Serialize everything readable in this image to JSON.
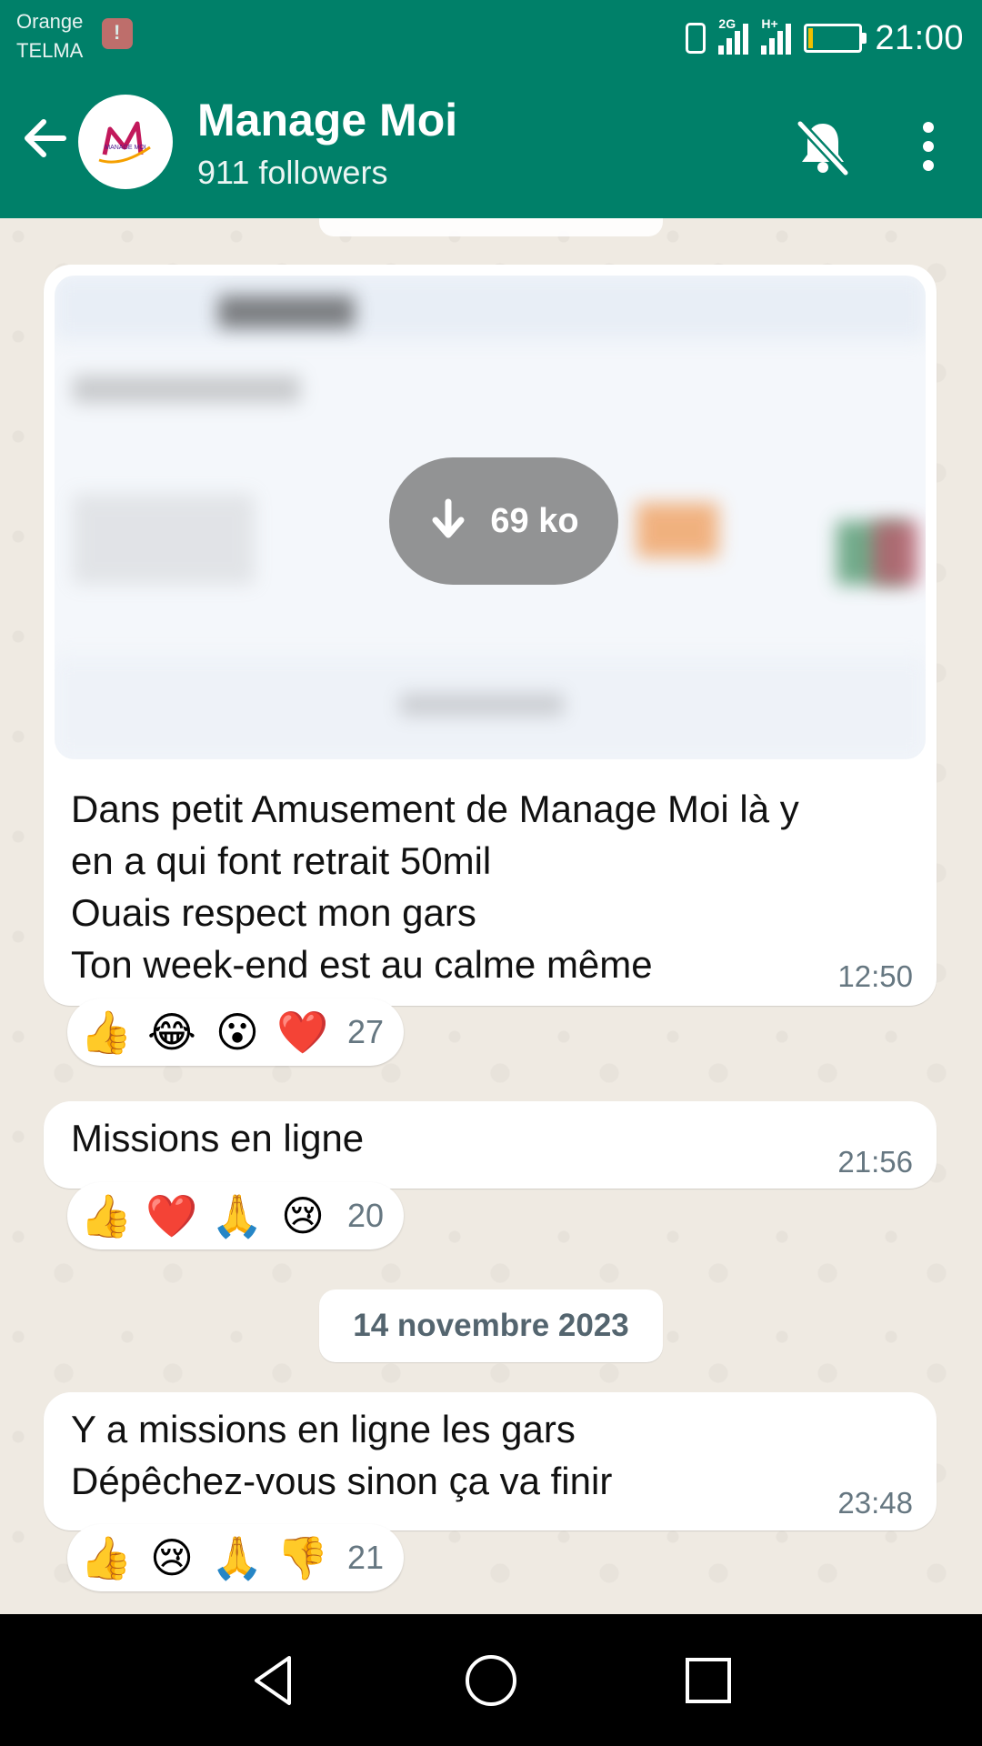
{
  "status_bar": {
    "carrier_line1": "Orange",
    "carrier_line2": "TELMA",
    "network_2g": "2G",
    "network_hplus": "H+",
    "time": "21:00",
    "icons": [
      "alert-icon",
      "vibrate-icon",
      "signal-2g-icon",
      "signal-hplus-icon",
      "battery-low-icon"
    ],
    "battery_color": "#f0c000"
  },
  "header": {
    "channel_name": "Manage Moi",
    "followers": "911 followers",
    "avatar_text": "MANAGE MOI",
    "icons": [
      "back-arrow-icon",
      "muted-bell-icon",
      "more-vert-icon"
    ],
    "accent_color": "#008069"
  },
  "messages": [
    {
      "media": {
        "download_size": "69 ko",
        "icon": "download-arrow-icon"
      },
      "lines": [
        "Dans petit Amusement de Manage Moi là y",
        "en a qui font retrait 50mil",
        "Ouais respect mon gars",
        "Ton week-end est au calme même"
      ],
      "time": "12:50",
      "reactions": {
        "emojis": [
          "👍",
          "😂",
          "😮",
          "❤️"
        ],
        "count": "27"
      }
    },
    {
      "lines": [
        "Missions en ligne"
      ],
      "time": "21:56",
      "reactions": {
        "emojis": [
          "👍",
          "❤️",
          "🙏",
          "😢"
        ],
        "count": "20"
      }
    },
    {
      "date_separator": "14 novembre 2023",
      "lines": [
        "Y a missions en ligne les gars",
        "Dépêchez-vous sinon ça va finir"
      ],
      "time": "23:48",
      "reactions": {
        "emojis": [
          "👍",
          "😢",
          "🙏",
          "👎"
        ],
        "count": "21"
      }
    }
  ],
  "nav_bar": {
    "icons": [
      "back-triangle-icon",
      "home-circle-icon",
      "recents-square-icon"
    ]
  },
  "colors": {
    "chat_background": "#efeae2",
    "bubble": "#ffffff",
    "meta_text": "#667781"
  }
}
